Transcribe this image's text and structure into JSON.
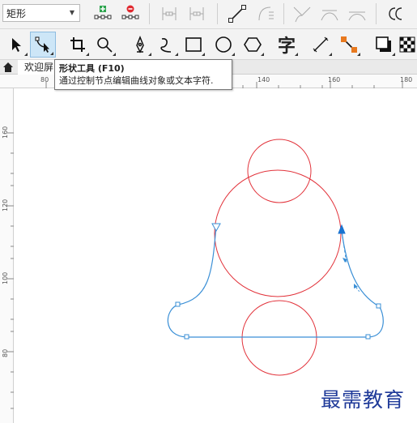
{
  "propbar": {
    "shape_select_value": "矩形"
  },
  "tabs": {
    "home_icon": "home-icon",
    "document_tab": "欢迎屏"
  },
  "rulers": {
    "horizontal": [
      "80",
      "140",
      "160",
      "180"
    ],
    "vertical": [
      "160",
      "120",
      "100",
      "80"
    ]
  },
  "tooltip": {
    "title": "形状工具 (F10)",
    "body": "通过控制节点编辑曲线对象或文本字符."
  },
  "toolbox": {
    "text_tool_glyph": "字"
  },
  "watermark": "最需教育",
  "colors": {
    "circles": "#e2333b",
    "curve": "#3a8fd6",
    "accent": "#cde6f7"
  }
}
